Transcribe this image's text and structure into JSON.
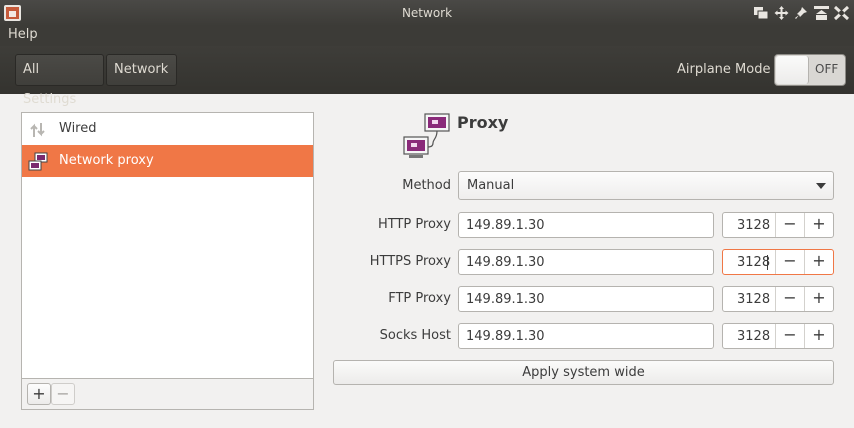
{
  "window": {
    "title": "Network"
  },
  "menu": {
    "help": "Help"
  },
  "header": {
    "crumbs": [
      "All Settings",
      "Network"
    ],
    "airplane_label": "Airplane Mode",
    "airplane_state": "OFF"
  },
  "sidebar": {
    "items": [
      {
        "label": "Wired",
        "icon": "wired-arrows-icon",
        "selected": false
      },
      {
        "label": "Network proxy",
        "icon": "network-proxy-icon",
        "selected": true
      }
    ],
    "add_label": "+",
    "remove_label": "−"
  },
  "proxy": {
    "title": "Proxy",
    "method_label": "Method",
    "method_value": "Manual",
    "rows": [
      {
        "label": "HTTP Proxy",
        "host": "149.89.1.30",
        "port": "3128",
        "focused": false
      },
      {
        "label": "HTTPS Proxy",
        "host": "149.89.1.30",
        "port": "3128",
        "focused": true
      },
      {
        "label": "FTP Proxy",
        "host": "149.89.1.30",
        "port": "3128",
        "focused": false
      },
      {
        "label": "Socks Host",
        "host": "149.89.1.30",
        "port": "3128",
        "focused": false
      }
    ],
    "minus": "−",
    "plus": "+",
    "apply_label": "Apply system wide"
  },
  "colors": {
    "accent": "#f07746",
    "titlebar": "#3c3b37",
    "icon_purple": "#8a2a7a"
  }
}
